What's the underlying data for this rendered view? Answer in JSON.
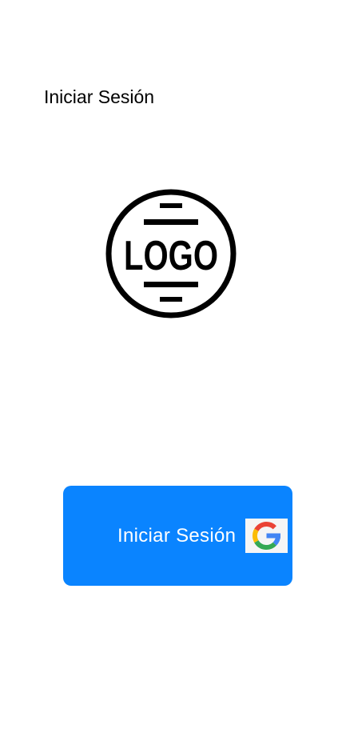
{
  "header": {
    "title": "Iniciar Sesión"
  },
  "logo": {
    "text": "LOGO",
    "icon": "logo-emblem"
  },
  "login_button": {
    "label": "Iniciar Sesión",
    "icon": "google-icon",
    "background_color": "#0A84FF",
    "text_color": "#FFFFFF"
  },
  "colors": {
    "google_blue": "#4285F4",
    "google_red": "#EA4335",
    "google_yellow": "#FBBC05",
    "google_green": "#34A853"
  }
}
